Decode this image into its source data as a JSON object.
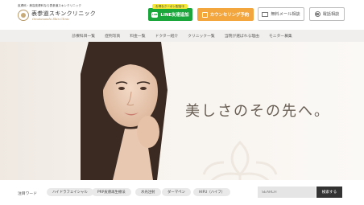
{
  "header": {
    "tagline": "皮膚科・美容皮膚科なら表参道スキンクリニック",
    "logo_jp": "表参道スキンクリニック",
    "logo_en": "Omotesando Skin Clinic",
    "coupon_label": "お得なクーポン配信中",
    "line_button": "LINE友達追加",
    "counsel_button": "カウンセリング予約",
    "mail_button": "無料メール相談",
    "tel_button": "電話相談"
  },
  "nav": {
    "items": [
      "診療科目一覧",
      "症例写真",
      "料金一覧",
      "ドクター紹介",
      "クリニック一覧",
      "当院が選ばれる理由",
      "モニター募集"
    ]
  },
  "hero": {
    "headline": "美しさのその先へ。"
  },
  "keywords": {
    "label": "注目ワード",
    "items": [
      "ハイドラフェイシャル",
      "PRP皮膚再生療法",
      "水光注射",
      "ダーマペン",
      "HIFU（ハイフ）"
    ]
  },
  "search": {
    "placeholder": "SEARCH",
    "button": "検索する"
  },
  "colors": {
    "line_green": "#1aa63a",
    "counsel_orange": "#f3a63e",
    "coupon_yellow": "#f6e83a",
    "nav_bg": "#f1efed",
    "search_btn": "#333333"
  }
}
